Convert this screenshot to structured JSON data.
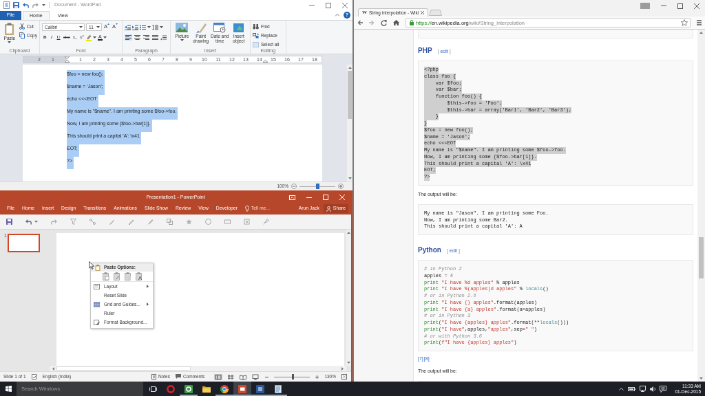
{
  "wordpad": {
    "title": "Document - WordPad",
    "tabs": [
      {
        "label": "File",
        "kind": "file",
        "selected": false
      },
      {
        "label": "Home",
        "kind": "tab",
        "selected": true
      },
      {
        "label": "View",
        "kind": "tab",
        "selected": false
      }
    ],
    "help": "?",
    "clipboard": {
      "paste": "Paste",
      "cut": "Cut",
      "copy": "Copy",
      "group": "Clipboard"
    },
    "font": {
      "family": "Calibri",
      "size": "11",
      "grow": "A",
      "shrink": "A",
      "styles": [
        "B",
        "I",
        "U",
        "abc",
        "x₂",
        "x²"
      ],
      "color_label": "A",
      "group": "Font"
    },
    "paragraph": {
      "alignments": [
        {
          "selected": true
        },
        {
          "selected": false
        },
        {
          "selected": false
        },
        {
          "selected": false
        }
      ],
      "group": "Paragraph"
    },
    "insert": {
      "items": [
        {
          "label": "Picture",
          "dropdown": true
        },
        {
          "label": "Paint drawing",
          "dropdown": false
        },
        {
          "label": "Date and time",
          "dropdown": false
        },
        {
          "label": "Insert object",
          "dropdown": false
        }
      ],
      "group": "Insert"
    },
    "editing": {
      "items": [
        "Find",
        "Replace",
        "Select all"
      ],
      "group": "Editing"
    },
    "ruler": {
      "before_indent": [
        "2",
        "1"
      ],
      "after_indent": [
        "1",
        "2",
        "3",
        "4",
        "5",
        "6",
        "7",
        "8",
        "9",
        "10",
        "11",
        "12",
        "13",
        "14",
        "15",
        "16",
        "17",
        "18"
      ]
    },
    "lines": [
      {
        "text": "$foo = new foo();",
        "selected": true
      },
      {
        "text": "$name = 'Jason';",
        "selected": true
      },
      {
        "text": "echo <<<EOT",
        "selected": true
      },
      {
        "text": "My name is \"$name\". I am printing some $foo->foo.",
        "selected": true
      },
      {
        "text": "Now, I am printing some {$foo->bar[1]}.",
        "selected": true
      },
      {
        "text": "This should print a capital 'A': \\x41",
        "selected": true
      },
      {
        "text": "EOT;",
        "selected": true
      },
      {
        "text": "?>",
        "selected": true
      }
    ],
    "status": {
      "zoom": "100%",
      "level": 0.5
    }
  },
  "powerpoint": {
    "title": "Presentation1 - PowerPoint",
    "tabs": [
      {
        "label": "File",
        "selected": false
      },
      {
        "label": "Home",
        "selected": false
      },
      {
        "label": "Insert",
        "selected": false
      },
      {
        "label": "Design",
        "selected": false
      },
      {
        "label": "Transitions",
        "selected": false
      },
      {
        "label": "Animations",
        "selected": false
      },
      {
        "label": "Slide Show",
        "selected": false
      },
      {
        "label": "Review",
        "selected": false
      },
      {
        "label": "View",
        "selected": false
      },
      {
        "label": "Developer",
        "selected": false
      }
    ],
    "tell_me": "Tell me...",
    "user": "Arun Jack",
    "share": "Share",
    "slides": [
      {
        "number": "1",
        "selected": true
      }
    ],
    "context_menu": {
      "header": "Paste Options:",
      "items": [
        {
          "label": "Layout",
          "submenu": true
        },
        {
          "label": "Reset Slide",
          "submenu": false
        },
        {
          "label": "Grid and Guides...",
          "submenu": true
        },
        {
          "label": "Ruler",
          "submenu": false
        },
        {
          "label": "Format Background...",
          "submenu": false
        }
      ]
    },
    "status": {
      "slide": "Slide 1 of 1",
      "language": "English (India)",
      "notes": "Notes",
      "comments": "Comments",
      "views": [
        {
          "selected": true
        },
        {
          "selected": false
        },
        {
          "selected": false
        },
        {
          "selected": false
        }
      ],
      "zoom": "130%",
      "level": 0.53
    }
  },
  "browser": {
    "tab": {
      "favicon": "W",
      "title": "String interpolation - Wiki"
    },
    "url": {
      "scheme": "https://",
      "host": "en.wikipedia.org",
      "path": "/wiki/String_interpolation"
    },
    "content": [
      {
        "kind": "heading",
        "text": "PHP",
        "edit": {
          "open": "[",
          "label": "edit",
          "close": "]"
        }
      },
      {
        "kind": "code",
        "lines": [
          {
            "text": "<?php",
            "selected": true
          },
          {
            "text": "class foo {",
            "selected": true
          },
          {
            "text": "    var $foo;",
            "selected": true
          },
          {
            "text": "    var $bar;",
            "selected": true
          },
          {
            "text": "    function foo() {",
            "selected": true
          },
          {
            "text": "        $this->foo = 'Foo';",
            "selected": true
          },
          {
            "text": "        $this->bar = array('Bar1', 'Bar2', 'Bar3');",
            "selected": true
          },
          {
            "text": "    }",
            "selected": true
          },
          {
            "text": "}",
            "selected": true
          },
          {
            "text": "$foo = new foo();",
            "selected": true
          },
          {
            "text": "$name = 'Jason';",
            "selected": true
          },
          {
            "text": "echo <<<EOT",
            "selected": true
          },
          {
            "text": "My name is \"$name\". I am printing some $foo->foo.",
            "selected": true
          },
          {
            "text": "Now, I am printing some {$foo->bar[1]}.",
            "selected": true
          },
          {
            "text": "This should print a capital 'A': \\x41",
            "selected": true
          },
          {
            "text": "EOT;",
            "selected": true
          },
          {
            "text": "?>",
            "selected": true
          }
        ]
      },
      {
        "kind": "text",
        "text": "The output will be:"
      },
      {
        "kind": "code",
        "lines": [
          {
            "text": "My name is \"Jason\". I am printing some Foo.",
            "selected": false
          },
          {
            "text": "Now, I am printing some Bar2.",
            "selected": false
          },
          {
            "text": "This should print a capital 'A': A",
            "selected": false
          }
        ]
      },
      {
        "kind": "heading",
        "text": "Python",
        "edit": {
          "open": "[",
          "label": "edit",
          "close": "]"
        }
      },
      {
        "kind": "code",
        "lines": [
          {
            "selected": false,
            "segments": [
              {
                "text": "# in Python 2",
                "kind": "comment"
              }
            ]
          },
          {
            "selected": false,
            "segments": [
              {
                "text": "apples",
                "kind": "plain"
              },
              {
                "text": " = ",
                "kind": "operator"
              },
              {
                "text": "4",
                "kind": "number"
              }
            ]
          },
          {
            "selected": false,
            "segments": [
              {
                "text": "print ",
                "kind": "keyword"
              },
              {
                "text": "\"I have %d apples\"",
                "kind": "string"
              },
              {
                "text": " % apples",
                "kind": "plain"
              }
            ]
          },
          {
            "selected": false,
            "segments": [
              {
                "text": "print ",
                "kind": "keyword"
              },
              {
                "text": "\"I have %(apples)d apples\"",
                "kind": "string"
              },
              {
                "text": " % ",
                "kind": "plain"
              },
              {
                "text": "locals",
                "kind": "builtin"
              },
              {
                "text": "()",
                "kind": "plain"
              }
            ]
          },
          {
            "selected": false,
            "segments": [
              {
                "text": "# or in Python 2.6",
                "kind": "comment"
              }
            ]
          },
          {
            "selected": false,
            "segments": [
              {
                "text": "print ",
                "kind": "keyword"
              },
              {
                "text": "\"I have {} apples\"",
                "kind": "string"
              },
              {
                "text": ".format(apples)",
                "kind": "plain"
              }
            ]
          },
          {
            "selected": false,
            "segments": [
              {
                "text": "print ",
                "kind": "keyword"
              },
              {
                "text": "\"I have {a} apples\"",
                "kind": "string"
              },
              {
                "text": ".format(a=apples)",
                "kind": "plain"
              }
            ]
          },
          {
            "selected": false,
            "segments": [
              {
                "text": "# or in Python 3",
                "kind": "comment"
              }
            ]
          },
          {
            "selected": false,
            "segments": [
              {
                "text": "print",
                "kind": "keyword"
              },
              {
                "text": "(",
                "kind": "plain"
              },
              {
                "text": "\"I have {apples} apples\"",
                "kind": "string"
              },
              {
                "text": ".format(**",
                "kind": "plain"
              },
              {
                "text": "locals",
                "kind": "builtin"
              },
              {
                "text": "()))",
                "kind": "plain"
              }
            ]
          },
          {
            "selected": false,
            "segments": [
              {
                "text": "print",
                "kind": "keyword"
              },
              {
                "text": "(",
                "kind": "plain"
              },
              {
                "text": "\"I have\"",
                "kind": "string"
              },
              {
                "text": ",apples,",
                "kind": "plain"
              },
              {
                "text": "\"apples\"",
                "kind": "string"
              },
              {
                "text": ",sep=",
                "kind": "plain"
              },
              {
                "text": "\" \"",
                "kind": "string"
              },
              {
                "text": ")",
                "kind": "plain"
              }
            ]
          },
          {
            "selected": false,
            "segments": [
              {
                "text": "# or with Python 3.6",
                "kind": "comment"
              }
            ]
          },
          {
            "selected": false,
            "segments": [
              {
                "text": "print",
                "kind": "keyword"
              },
              {
                "text": "(",
                "kind": "plain"
              },
              {
                "text": "f\"I have {apples} apples\"",
                "kind": "string"
              },
              {
                "text": ")",
                "kind": "plain"
              }
            ]
          }
        ]
      },
      {
        "kind": "refs",
        "refs": [
          "[7]",
          "[8]"
        ]
      },
      {
        "kind": "text",
        "text": "The output will be:"
      }
    ]
  },
  "taskbar": {
    "search": {
      "placeholder": "Search Windows"
    },
    "apps": [
      {
        "running": false,
        "active": false
      },
      {
        "running": true,
        "active": false
      },
      {
        "running": false,
        "active": false
      },
      {
        "running": true,
        "active": false
      },
      {
        "running": true,
        "active": true
      },
      {
        "running": true,
        "active": false
      },
      {
        "running": true,
        "active": false
      }
    ],
    "time": "11:33 AM",
    "date": "01-Dec-2015"
  }
}
